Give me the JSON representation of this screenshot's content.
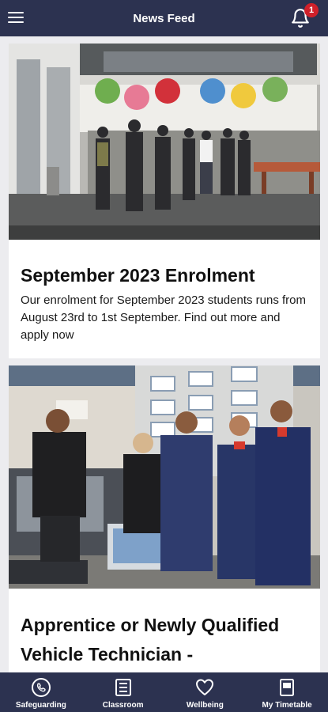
{
  "header": {
    "title": "News Feed",
    "notifications_count": "1"
  },
  "feed": [
    {
      "image": "students walking through college atrium",
      "title": "September 2023 Enrolment",
      "body": "Our enrolment for September 2023 students runs from August 23rd to 1st September. Find out more and apply now"
    },
    {
      "image": "automotive apprentices posing in workshop",
      "title": "Apprentice or Newly Qualified Vehicle Technician -"
    }
  ],
  "tabs": [
    {
      "label": "Safeguarding",
      "icon": "phone-icon"
    },
    {
      "label": "Classroom",
      "icon": "classroom-icon"
    },
    {
      "label": "Wellbeing",
      "icon": "heart-icon"
    },
    {
      "label": "My Timetable",
      "icon": "timetable-icon"
    }
  ],
  "colors": {
    "bar": "#2c3250",
    "badge": "#d0202a",
    "card": "#ffffff",
    "background": "#ececef"
  }
}
